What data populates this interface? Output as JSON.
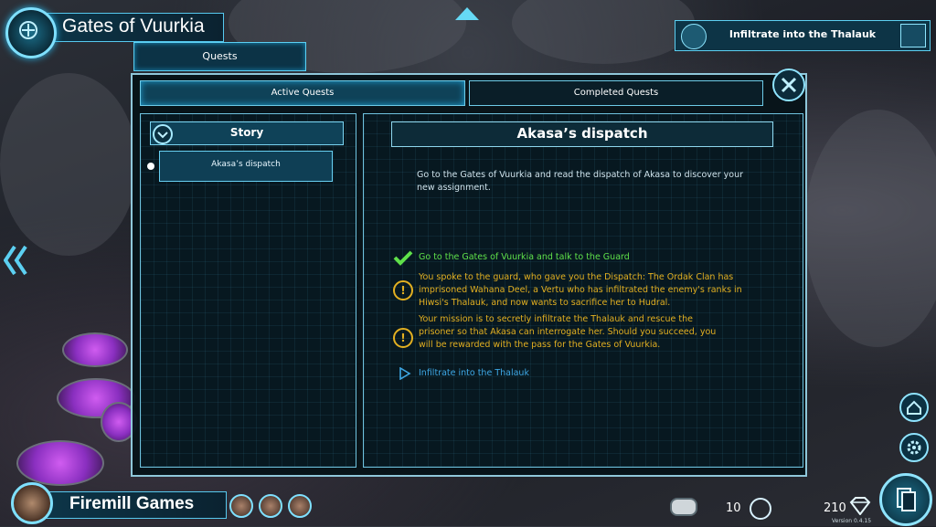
{
  "location": {
    "title": "Gates of Vuurkia"
  },
  "header": {
    "quests_tab": "Quests"
  },
  "tracked_quest": {
    "label": "Infiltrate into the Thalauk"
  },
  "tabs": {
    "active": "Active Quests",
    "completed": "Completed Quests"
  },
  "quest_list": {
    "category": "Story",
    "items": [
      {
        "label": "Akasa’s dispatch"
      }
    ]
  },
  "quest_detail": {
    "title": "Akasa’s dispatch",
    "description": "Go to the Gates of Vuurkia and read the dispatch of Akasa to discover your new assignment.",
    "steps": [
      {
        "status": "completed",
        "icon": "checkmark-icon",
        "color": "#5fe04a",
        "text": "Go to the Gates of Vuurkia and talk to the Guard"
      },
      {
        "status": "info",
        "icon": "exclamation-icon",
        "color": "#e3b021",
        "text": "You spoke to the guard, who gave you the Dispatch: The Ordak Clan has imprisoned Wahana Deel, a Vertu who has infiltrated the enemy's ranks in Hiwsi's Thalauk, and now wants to sacrifice her to Hudral."
      },
      {
        "status": "info",
        "icon": "exclamation-icon",
        "color": "#e3b021",
        "text": "Your mission is to secretly infiltrate the Thalauk and rescue the prisoner so that Akasa can interrogate her. Should you succeed, you will be rewarded with the pass for the Gates of Vuurkia."
      },
      {
        "status": "current",
        "icon": "play-arrow-icon",
        "color": "#3ea8e6",
        "text": "Infiltrate into the Thalauk"
      }
    ]
  },
  "player": {
    "name": "Firemill Games"
  },
  "resources": {
    "energy": "10",
    "gems": "210"
  },
  "version": "Version 0.4.15",
  "colors": {
    "accent": "#5cd0f2",
    "panel": "#071820",
    "warning": "#e3b021",
    "done": "#5fe04a",
    "current": "#3ea8e6"
  }
}
